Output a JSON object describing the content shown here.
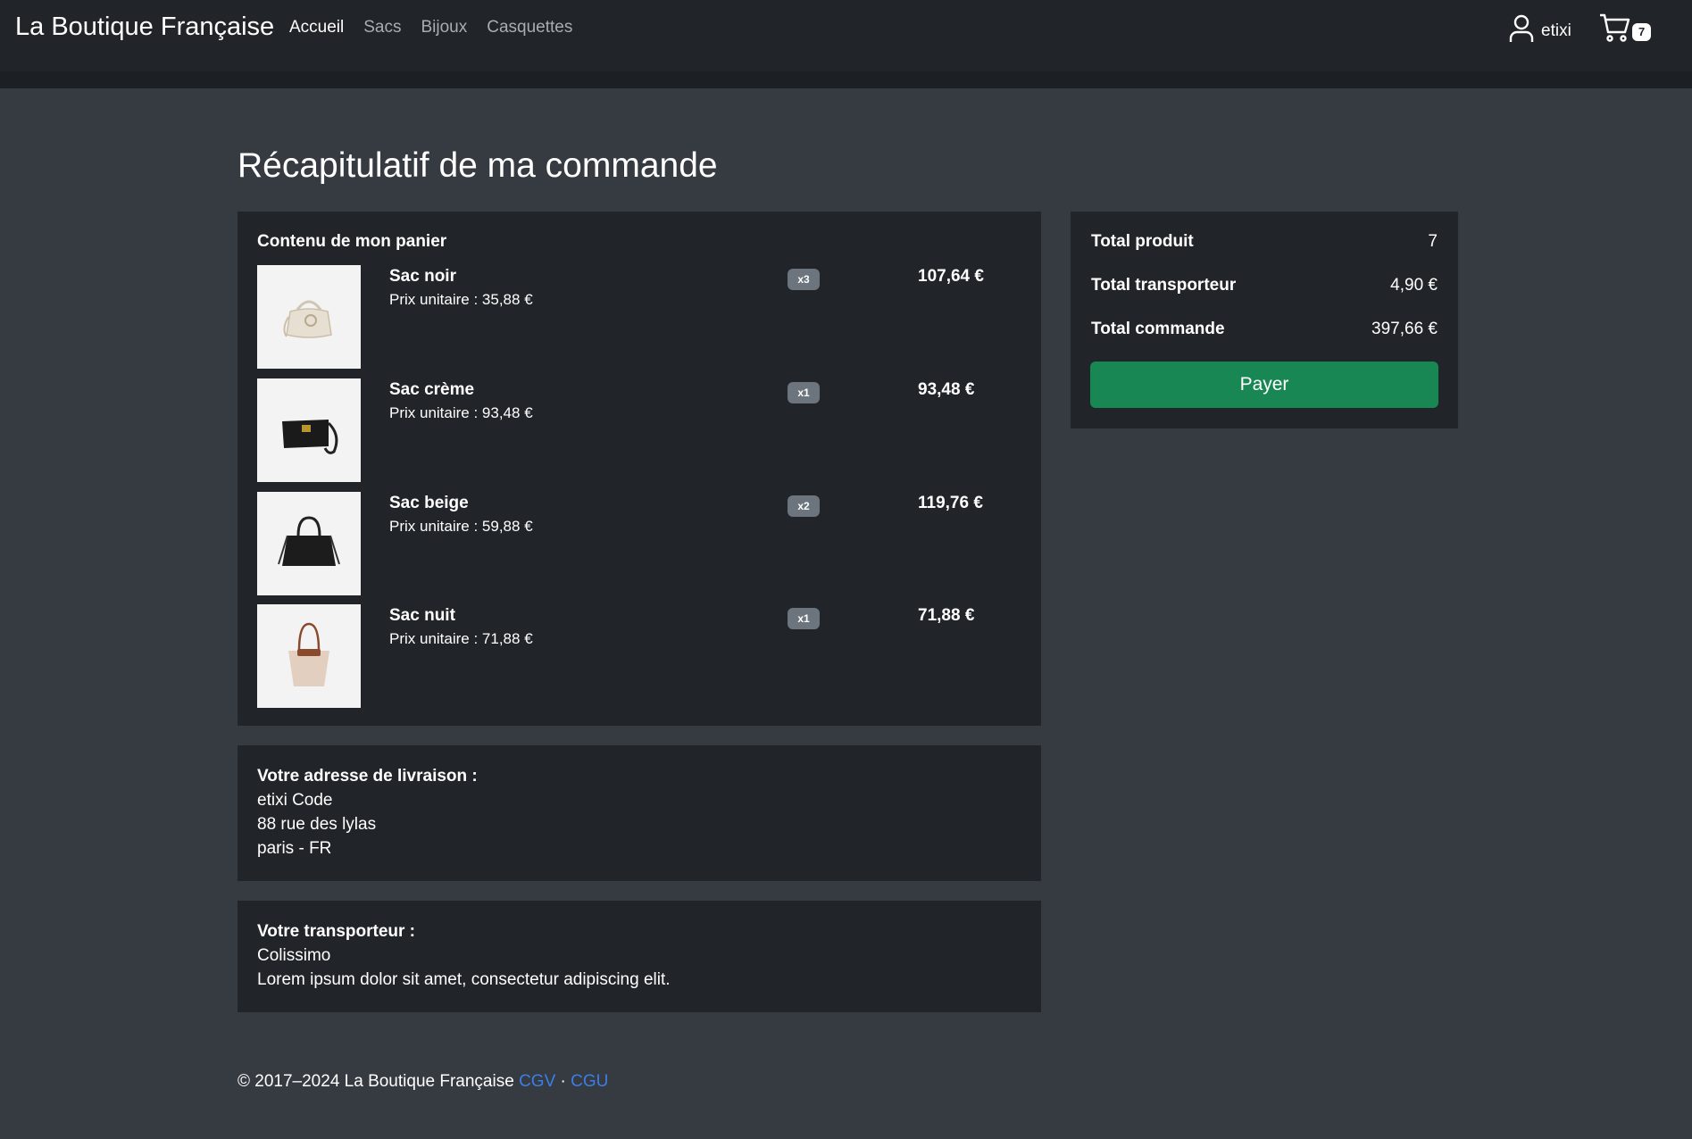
{
  "navbar": {
    "brand": "La Boutique Française",
    "links": [
      {
        "label": "Accueil",
        "active": true
      },
      {
        "label": "Sacs",
        "active": false
      },
      {
        "label": "Bijoux",
        "active": false
      },
      {
        "label": "Casquettes",
        "active": false
      }
    ],
    "user_name": "etixi",
    "cart_count": "7"
  },
  "page_title": "Récapitulatif de ma commande",
  "cart": {
    "heading": "Contenu de mon panier",
    "items": [
      {
        "name": "Sac noir",
        "unit_price": "Prix unitaire : 35,88 €",
        "qty": "x3",
        "total": "107,64 €",
        "image": "cream-handbag"
      },
      {
        "name": "Sac crème",
        "unit_price": "Prix unitaire : 93,48 €",
        "qty": "x1",
        "total": "93,48 €",
        "image": "black-shoulder-bag"
      },
      {
        "name": "Sac beige",
        "unit_price": "Prix unitaire : 59,88 €",
        "qty": "x2",
        "total": "119,76 €",
        "image": "black-tote-bag"
      },
      {
        "name": "Sac nuit",
        "unit_price": "Prix unitaire : 71,88 €",
        "qty": "x1",
        "total": "71,88 €",
        "image": "beige-tote-bag"
      }
    ]
  },
  "summary": {
    "product_label": "Total produit",
    "product_value": "7",
    "carrier_label": "Total transporteur",
    "carrier_value": "4,90 €",
    "order_label": "Total commande",
    "order_value": "397,66 €",
    "pay_label": "Payer"
  },
  "address": {
    "title": "Votre adresse de livraison :",
    "lines": [
      "etixi Code",
      "88 rue des lylas",
      "paris - FR"
    ]
  },
  "carrier": {
    "title": "Votre transporteur :",
    "name": "Colissimo",
    "description": "Lorem ipsum dolor sit amet, consectetur adipiscing elit."
  },
  "footer": {
    "text": "© 2017–2024 La Boutique Française",
    "link1": "CGV",
    "separator": "·",
    "link2": "CGU"
  },
  "colors": {
    "background": "#363a41",
    "navbar": "#212529",
    "panel": "#212529",
    "pay_button": "#198754",
    "link": "#3d7ee6"
  }
}
